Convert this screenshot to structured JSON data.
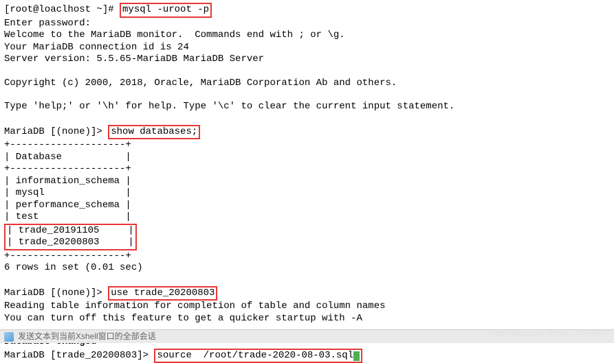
{
  "line1_prompt": "[root@loaclhost ~]# ",
  "line1_cmd": "mysql -uroot -p",
  "enter_password": "Enter password:",
  "welcome": "Welcome to the MariaDB monitor.  Commands end with ; or \\g.",
  "conn_id": "Your MariaDB connection id is 24",
  "server_version": "Server version: 5.5.65-MariaDB MariaDB Server",
  "copyright": "Copyright (c) 2000, 2018, Oracle, MariaDB Corporation Ab and others.",
  "help_line": "Type 'help;' or '\\h' for help. Type '\\c' to clear the current input statement.",
  "prompt_none": "MariaDB [(none)]> ",
  "cmd_show_db": "show databases;",
  "table_top": "+--------------------+",
  "table_header": "| Database           |",
  "table_sep": "+--------------------+",
  "db_rows_plain": [
    "| information_schema |",
    "| mysql              |",
    "| performance_schema |",
    "| test               |"
  ],
  "db_rows_highlighted": [
    "| trade_20191105     |",
    "| trade_20200803     |"
  ],
  "table_bottom": "+--------------------+",
  "rows_in_set": "6 rows in set (0.01 sec)",
  "cmd_use": "use trade_20200803",
  "reading_info": "Reading table information for completion of table and column names",
  "turnoff_info": "You can turn off this feature to get a quicker startup with -A",
  "db_changed": "Database changed",
  "prompt_trade": "MariaDB [trade_20200803]> ",
  "cmd_source": "source  /root/trade-2020-08-03.sql",
  "footer_text": "发送文本到当前Xshell窗口的全部会话",
  "watermark_text": "https://blog.csdn.net/lkm_43779302"
}
